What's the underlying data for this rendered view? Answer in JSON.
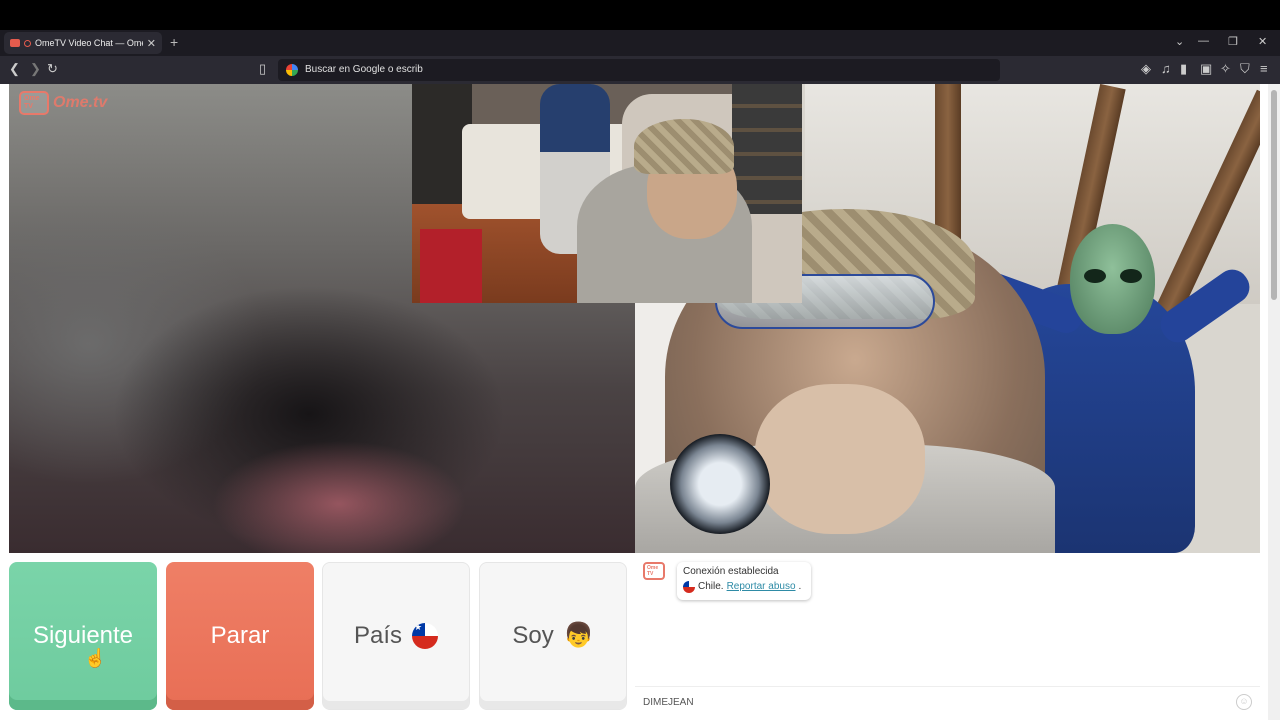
{
  "browser": {
    "tab_title": "OmeTV Video Chat — Omeg",
    "tab_close": "✕",
    "new_tab": "+",
    "url_placeholder": "Buscar en Google o escrib",
    "window_controls": [
      "⌄",
      "—",
      "❐",
      "✕"
    ]
  },
  "site": {
    "logo_small": "Ome TV",
    "logo_text": "Ome.tv"
  },
  "buttons": {
    "next": "Siguiente",
    "stop": "Parar",
    "country": "País",
    "me": "Soy"
  },
  "chat": {
    "logo_small": "Ome TV",
    "status": "Conexión establecida",
    "country": "Chile.",
    "report": "Reportar abuso",
    "report_suffix": ".",
    "input_value": "DIMEJEAN"
  },
  "colors": {
    "next": "#6ecb9e",
    "stop": "#e86e55",
    "brand": "#e8796a",
    "link": "#2e8ba6"
  },
  "icons": {
    "back": "chevron-left-icon",
    "forward": "chevron-right-icon",
    "reload": "reload-icon",
    "bookmark": "bookmark-icon",
    "country_flag": "chile-flag-icon",
    "me_face": "boy-face-icon",
    "emoji": "smiley-icon"
  }
}
